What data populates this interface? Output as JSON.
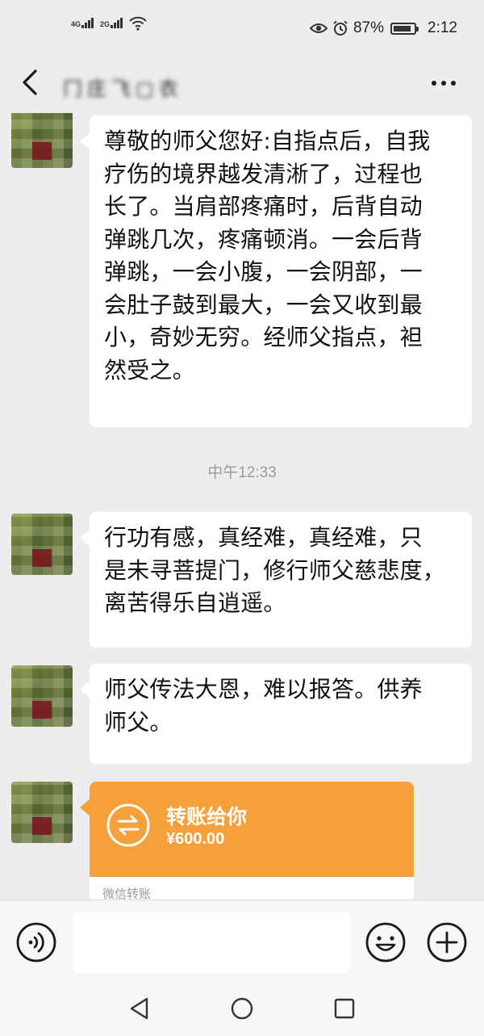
{
  "status_bar": {
    "sim1_label": "4G",
    "sim2_label": "2G",
    "battery_percent": "87%",
    "battery_level": 0.87,
    "time": "2:12"
  },
  "header": {
    "title": "冂庄飞▢衣"
  },
  "messages": [
    {
      "lines": [
        "尊敬的师父您好:自指点后，自我",
        "疗伤的境界越发清淅了，过程也",
        "长了。当肩部疼痛时，后背自动",
        "弹跳几次，疼痛顿消。一会后背",
        "弹跳，一会小腹，一会阴部，一",
        "会肚子鼓到最大，一会又收到最",
        "小，奇妙无穷。经师父指点，袒",
        "然受之。"
      ]
    },
    {
      "lines": [
        "行功有感，真经难，真经难，只",
        "是未寻菩提门，修行师父慈悲度，",
        "离苦得乐自逍遥。"
      ]
    },
    {
      "lines": [
        "师父传法大恩，难以报答。供养",
        "师父。"
      ]
    }
  ],
  "timestamp": "中午12:33",
  "transfer": {
    "title": "转账给你",
    "amount": "¥600.00",
    "footer": "微信转账"
  },
  "icons": {
    "back": "back-chevron-icon",
    "more": "more-dots-icon",
    "voice": "voice-icon",
    "emoji": "emoji-icon",
    "plus": "plus-icon",
    "transfer": "transfer-arrows-icon"
  },
  "colors": {
    "background": "#ededed",
    "bubble": "#ffffff",
    "transfer": "#f6a03b",
    "timestamp": "#9b9b9b"
  }
}
